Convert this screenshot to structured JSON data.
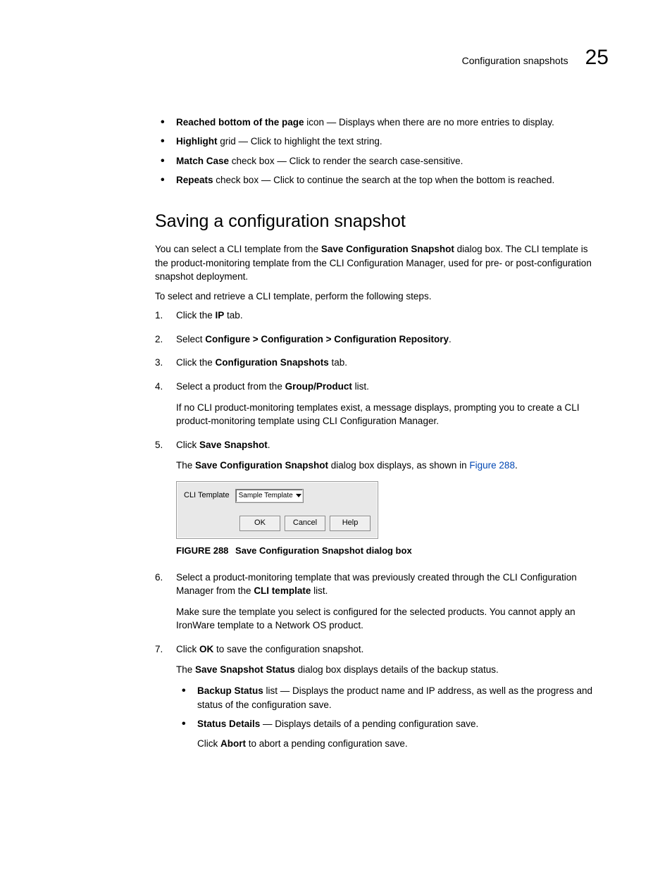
{
  "header": {
    "section": "Configuration snapshots",
    "chapter": "25"
  },
  "intro_bullets": [
    {
      "bold": "Reached bottom of the page",
      "rest": " icon — Displays when there are no more entries to display."
    },
    {
      "bold": "Highlight",
      "rest": " grid — Click to highlight the text string."
    },
    {
      "bold": "Match Case",
      "rest": " check box — Click to render the search case-sensitive."
    },
    {
      "bold": "Repeats",
      "rest": " check box — Click to continue the search at the top when the bottom is reached."
    }
  ],
  "section_title": "Saving a configuration snapshot",
  "para1_a": "You can select a CLI template from the ",
  "para1_bold": "Save Configuration Snapshot",
  "para1_b": " dialog box. The CLI template is the product-monitoring template from the CLI Configuration Manager, used for pre- or post-configuration snapshot deployment.",
  "para2": "To select and retrieve a CLI template, perform the following steps.",
  "step1": {
    "a": "Click the ",
    "bold": "IP",
    "b": " tab."
  },
  "step2": {
    "a": "Select ",
    "bold": "Configure > Configuration > Configuration Repository",
    "b": "."
  },
  "step3": {
    "a": "Click the ",
    "bold": "Configuration Snapshots",
    "b": " tab."
  },
  "step4": {
    "a": "Select a product from the ",
    "bold": "Group/Product",
    "b": " list.",
    "p": "If no CLI product-monitoring templates exist, a message displays, prompting you to create a CLI product-monitoring template using CLI Configuration Manager."
  },
  "step5": {
    "a": "Click ",
    "bold": "Save Snapshot",
    "b": ".",
    "p_a": "The ",
    "p_bold": "Save Configuration Snapshot",
    "p_b": " dialog box displays, as shown in ",
    "link": "Figure 288",
    "p_c": "."
  },
  "dialog": {
    "label": "CLI Template",
    "selected": "Sample Template",
    "ok": "OK",
    "cancel": "Cancel",
    "help": "Help"
  },
  "figure": {
    "label": "FIGURE 288",
    "title": "Save Configuration Snapshot dialog box"
  },
  "step6": {
    "a": "Select a product-monitoring template that was previously created through the CLI Configuration Manager from the ",
    "bold": "CLI template",
    "b": " list.",
    "p": "Make sure the template you select is configured for the selected products. You cannot apply an IronWare template to a Network OS product."
  },
  "step7": {
    "a": "Click ",
    "bold": "OK",
    "b": " to save the configuration snapshot.",
    "p_a": "The ",
    "p_bold": "Save Snapshot Status",
    "p_b": " dialog box displays details of the backup status.",
    "bullets": [
      {
        "bold": "Backup Status",
        "rest": " list — Displays the product name and IP address, as well as the progress and status of the configuration save."
      },
      {
        "bold": "Status Details",
        "rest": " — Displays details of a pending configuration save.",
        "p_a": "Click ",
        "p_bold": "Abort",
        "p_b": " to abort a pending configuration save."
      }
    ]
  }
}
